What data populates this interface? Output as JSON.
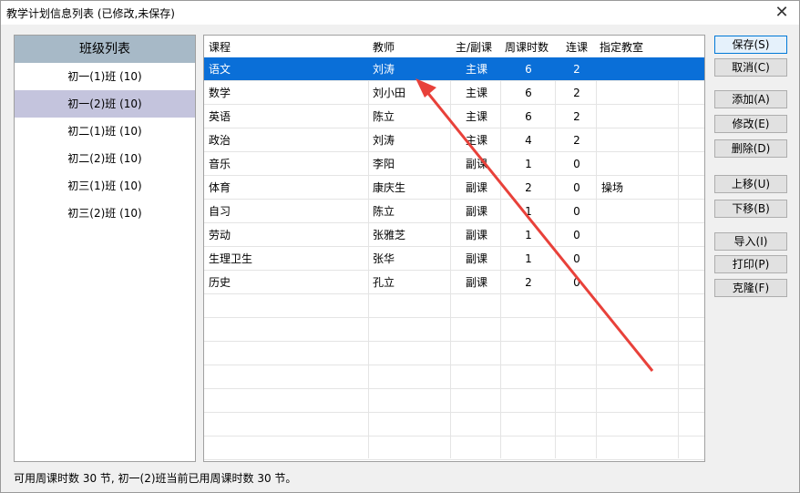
{
  "window": {
    "title": "教学计划信息列表 (已修改,未保存)",
    "close_glyph": "✕"
  },
  "class_panel": {
    "header": "班级列表",
    "items": [
      {
        "label": "初一(1)班 (10)"
      },
      {
        "label": "初一(2)班 (10)"
      },
      {
        "label": "初二(1)班 (10)"
      },
      {
        "label": "初二(2)班 (10)"
      },
      {
        "label": "初三(1)班 (10)"
      },
      {
        "label": "初三(2)班 (10)"
      }
    ],
    "selected_index": 1
  },
  "grid": {
    "columns": [
      "课程",
      "教师",
      "主/副课",
      "周课时数",
      "连课",
      "指定教室"
    ],
    "rows": [
      {
        "course": "语文",
        "teacher": "刘涛",
        "type": "主课",
        "hours": "6",
        "consec": "2",
        "room": ""
      },
      {
        "course": "数学",
        "teacher": "刘小田",
        "type": "主课",
        "hours": "6",
        "consec": "2",
        "room": ""
      },
      {
        "course": "英语",
        "teacher": "陈立",
        "type": "主课",
        "hours": "6",
        "consec": "2",
        "room": ""
      },
      {
        "course": "政治",
        "teacher": "刘涛",
        "type": "主课",
        "hours": "4",
        "consec": "2",
        "room": ""
      },
      {
        "course": "音乐",
        "teacher": "李阳",
        "type": "副课",
        "hours": "1",
        "consec": "0",
        "room": ""
      },
      {
        "course": "体育",
        "teacher": "康庆生",
        "type": "副课",
        "hours": "2",
        "consec": "0",
        "room": "操场"
      },
      {
        "course": "自习",
        "teacher": "陈立",
        "type": "副课",
        "hours": "1",
        "consec": "0",
        "room": ""
      },
      {
        "course": "劳动",
        "teacher": "张雅芝",
        "type": "副课",
        "hours": "1",
        "consec": "0",
        "room": ""
      },
      {
        "course": "生理卫生",
        "teacher": "张华",
        "type": "副课",
        "hours": "1",
        "consec": "0",
        "room": ""
      },
      {
        "course": "历史",
        "teacher": "孔立",
        "type": "副课",
        "hours": "2",
        "consec": "0",
        "room": ""
      }
    ],
    "selected_row": 0
  },
  "buttons": {
    "save": "保存(S)",
    "cancel": "取消(C)",
    "add": "添加(A)",
    "edit": "修改(E)",
    "delete": "删除(D)",
    "move_up": "上移(U)",
    "move_down": "下移(B)",
    "import": "导入(I)",
    "print": "打印(P)",
    "clone": "克隆(F)"
  },
  "status": {
    "text": "可用周课时数 30 节, 初一(2)班当前已用周课时数 30 节。"
  },
  "colors": {
    "selection": "#0a6fd8",
    "class_header": "#a7b9c7",
    "class_selected": "#c4c4dd",
    "annotation_arrow": "#e8413a"
  }
}
